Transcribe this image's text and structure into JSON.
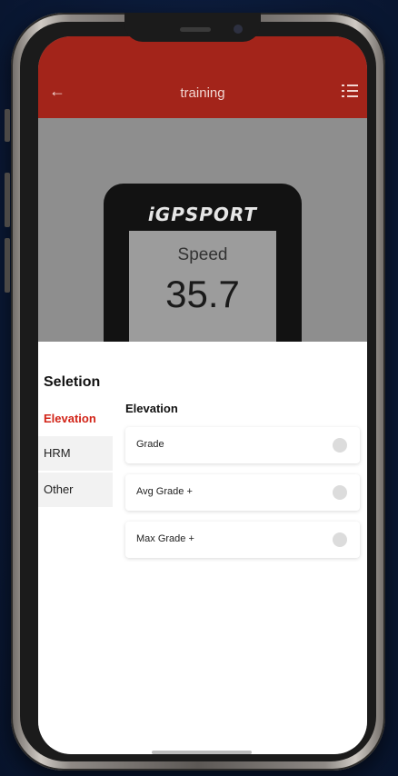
{
  "appbar": {
    "title": "training",
    "back_icon": "back-arrow-icon",
    "list_icon": "list-icon",
    "color": "#a3241a"
  },
  "device": {
    "brand": "iGPSPORT",
    "metric_label": "Speed",
    "metric_value": "35.7"
  },
  "sheet": {
    "title": "Seletion",
    "categories": [
      {
        "label": "Elevation",
        "active": true
      },
      {
        "label": "HRM",
        "active": false
      },
      {
        "label": "Other",
        "active": false
      }
    ],
    "section_title": "Elevation",
    "options": [
      {
        "label": "Grade"
      },
      {
        "label": "Avg Grade +"
      },
      {
        "label": "Max Grade +"
      }
    ]
  },
  "colors": {
    "accent": "#d22418"
  }
}
